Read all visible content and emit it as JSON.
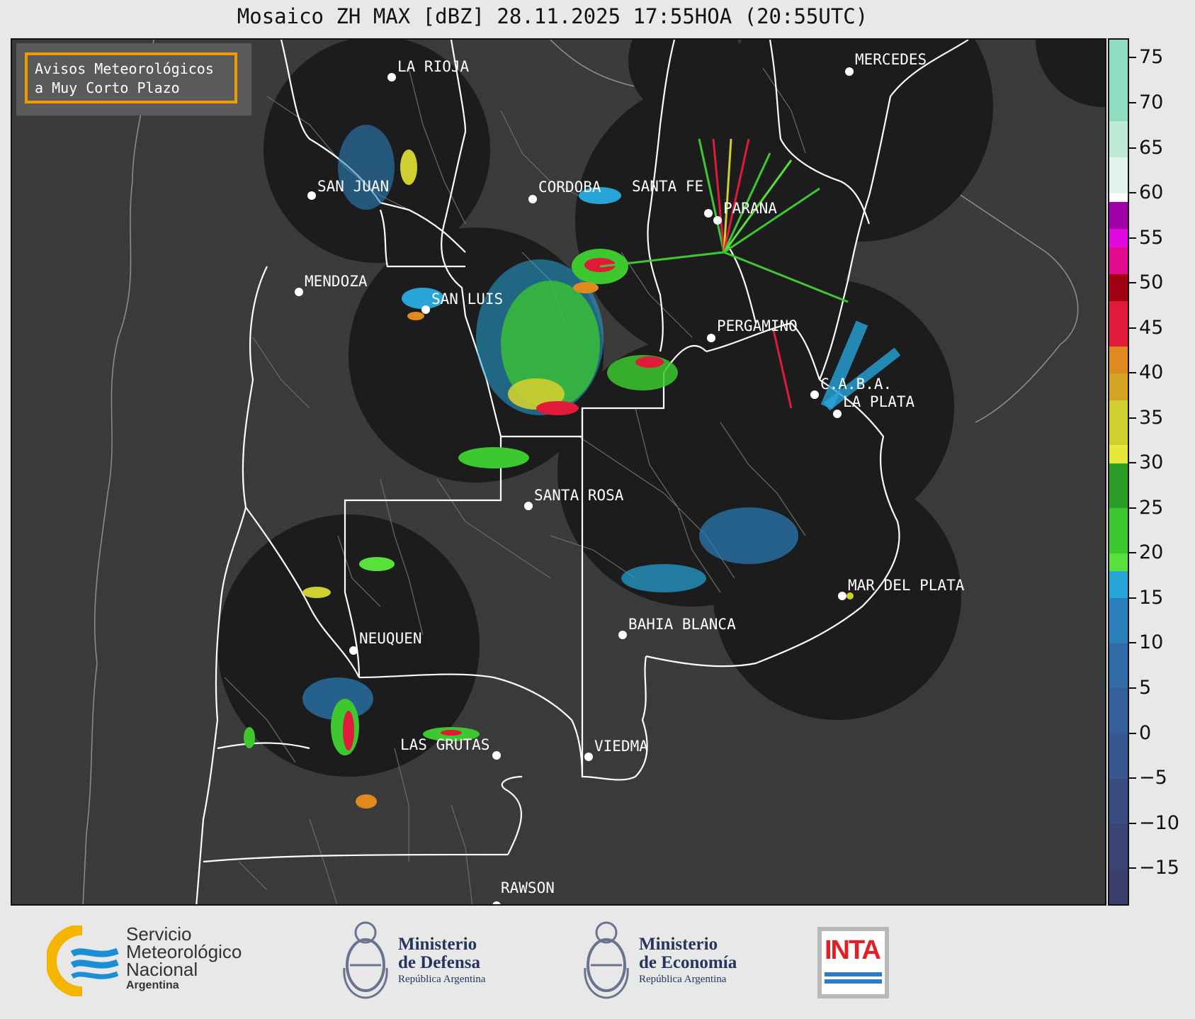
{
  "title": "Mosaico ZH MAX [dBZ] 28.11.2025 17:55HOA (20:55UTC)",
  "notice": {
    "line1": "Avisos Meteorológicos",
    "line2": "a Muy Corto Plazo"
  },
  "colors": {
    "background": "#e8e8e8",
    "map_sea": "#3a3a3a",
    "radar_coverage": "#1c1c1c",
    "notice_border": "#f19a00",
    "boundary": "#ffffff"
  },
  "cities": [
    {
      "name": "LA RIOJA",
      "icon": "city-dot-icon"
    },
    {
      "name": "MERCEDES",
      "icon": "city-dot-icon"
    },
    {
      "name": "SAN JUAN",
      "icon": "city-dot-icon"
    },
    {
      "name": "CORDOBA",
      "icon": "city-dot-icon"
    },
    {
      "name": "SANTA FE",
      "icon": "city-dot-icon"
    },
    {
      "name": "PARANA",
      "icon": "city-dot-icon"
    },
    {
      "name": "MENDOZA",
      "icon": "city-dot-icon"
    },
    {
      "name": "SAN LUIS",
      "icon": "city-dot-icon"
    },
    {
      "name": "PERGAMINO",
      "icon": "city-dot-icon"
    },
    {
      "name": "C.A.B.A.",
      "icon": "city-dot-icon"
    },
    {
      "name": "LA PLATA",
      "icon": "city-dot-icon"
    },
    {
      "name": "SANTA ROSA",
      "icon": "city-dot-icon"
    },
    {
      "name": "MAR DEL PLATA",
      "icon": "city-dot-icon"
    },
    {
      "name": "BAHIA BLANCA",
      "icon": "city-dot-icon"
    },
    {
      "name": "NEUQUEN",
      "icon": "city-dot-icon"
    },
    {
      "name": "LAS GRUTAS",
      "icon": "city-dot-icon"
    },
    {
      "name": "VIEDMA",
      "icon": "city-dot-icon"
    },
    {
      "name": "RAWSON",
      "icon": "city-dot-icon"
    }
  ],
  "colorbar": {
    "unit": "dBZ",
    "min": -19,
    "max": 77,
    "ticks": [
      "75",
      "70",
      "65",
      "60",
      "55",
      "50",
      "45",
      "40",
      "35",
      "30",
      "25",
      "20",
      "15",
      "10",
      "5",
      "0",
      "−5",
      "−10",
      "−15"
    ],
    "tick_values": [
      75,
      70,
      65,
      60,
      55,
      50,
      45,
      40,
      35,
      30,
      25,
      20,
      15,
      10,
      5,
      0,
      -5,
      -10,
      -15
    ],
    "bands": [
      {
        "from": -19,
        "to": -15,
        "color": "#3a3f6b"
      },
      {
        "from": -15,
        "to": -10,
        "color": "#3a4576"
      },
      {
        "from": -10,
        "to": -5,
        "color": "#3a4d82"
      },
      {
        "from": -5,
        "to": 0,
        "color": "#38568f"
      },
      {
        "from": 0,
        "to": 5,
        "color": "#35609c"
      },
      {
        "from": 5,
        "to": 10,
        "color": "#316ca9"
      },
      {
        "from": 10,
        "to": 15,
        "color": "#2b7fbb"
      },
      {
        "from": 15,
        "to": 18,
        "color": "#27a5d8"
      },
      {
        "from": 18,
        "to": 20,
        "color": "#5ae03a"
      },
      {
        "from": 20,
        "to": 25,
        "color": "#3cc82e"
      },
      {
        "from": 25,
        "to": 30,
        "color": "#2a9e26"
      },
      {
        "from": 30,
        "to": 32,
        "color": "#e8e83a"
      },
      {
        "from": 32,
        "to": 37,
        "color": "#cfcf30"
      },
      {
        "from": 37,
        "to": 40,
        "color": "#d4a224"
      },
      {
        "from": 40,
        "to": 43,
        "color": "#e08a1e"
      },
      {
        "from": 43,
        "to": 48,
        "color": "#e01a38"
      },
      {
        "from": 48,
        "to": 51,
        "color": "#9e0010"
      },
      {
        "from": 51,
        "to": 54,
        "color": "#e00a8c"
      },
      {
        "from": 54,
        "to": 56,
        "color": "#e00ae0"
      },
      {
        "from": 56,
        "to": 59,
        "color": "#a000a8"
      },
      {
        "from": 59,
        "to": 60,
        "color": "#ffffff"
      },
      {
        "from": 60,
        "to": 64,
        "color": "#e2f5ec"
      },
      {
        "from": 64,
        "to": 68,
        "color": "#bdebd8"
      },
      {
        "from": 68,
        "to": 77,
        "color": "#8fdcc0"
      }
    ]
  },
  "logos": {
    "smn": {
      "line1": "Servicio",
      "line2": "Meteorológico",
      "line3": "Nacional",
      "line4": "Argentina",
      "icon": "smn-logo-icon"
    },
    "defensa": {
      "line1": "Ministerio",
      "line2": "de Defensa",
      "line3": "República Argentina",
      "icon": "argentina-coat-of-arms-icon"
    },
    "economia": {
      "line1": "Ministerio",
      "line2": "de Economía",
      "line3": "República Argentina",
      "icon": "argentina-coat-of-arms-icon"
    },
    "inta": {
      "label": "INTA",
      "icon": "inta-logo-icon"
    }
  }
}
